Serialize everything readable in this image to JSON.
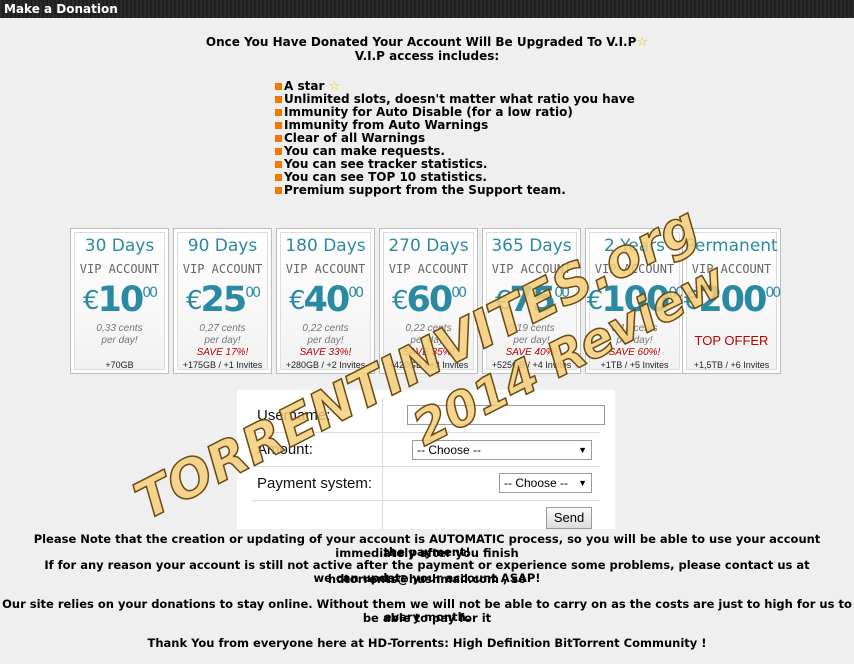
{
  "window": {
    "title": "Make a Donation"
  },
  "intro": {
    "headline": "Once You Have Donated Your Account Will Be Upgraded To V.I.P",
    "subline": "V.I.P access includes:"
  },
  "benefits": [
    "A star",
    "Unlimited slots, doesn't matter what ratio you have",
    "Immunity for Auto Disable (for a low ratio)",
    "Immunity from Auto Warnings",
    "Clear of all Warnings",
    "You can make requests.",
    "You can see tracker statistics.",
    "You can see TOP 10 statistics.",
    "Premium support from the Support team."
  ],
  "plans": [
    {
      "duration": "30 Days",
      "account": "VIP ACCOUNT",
      "currency": "€",
      "price": "10",
      "decimals": "00",
      "cents": "0,33 cents",
      "per": "per day!",
      "save": "",
      "extra": "+70GB"
    },
    {
      "duration": "90 Days",
      "account": "VIP ACCOUNT",
      "currency": "€",
      "price": "25",
      "decimals": "00",
      "cents": "0,27 cents",
      "per": "per day!",
      "save": "SAVE 17%!",
      "extra": "+175GB / +1 Invites"
    },
    {
      "duration": "180 Days",
      "account": "VIP ACCOUNT",
      "currency": "€",
      "price": "40",
      "decimals": "00",
      "cents": "0,22 cents",
      "per": "per day!",
      "save": "SAVE 33%!",
      "extra": "+280GB / +2 Invites"
    },
    {
      "duration": "270 Days",
      "account": "VIP ACCOUNT",
      "currency": "€",
      "price": "60",
      "decimals": "00",
      "cents": "0,22 cents",
      "per": "per day!",
      "save": "SAVE 35%!",
      "extra": "+420GB / +3 Invites"
    },
    {
      "duration": "365 Days",
      "account": "VIP ACCOUNT",
      "currency": "€",
      "price": "75",
      "decimals": "00",
      "cents": "0,19 cents",
      "per": "per day!",
      "save": "SAVE 40%!",
      "extra": "+525GB / +4 Invites"
    },
    {
      "duration": "2 Years",
      "account": "VIP ACCOUNT",
      "currency": "€",
      "price": "100",
      "decimals": "00",
      "cents": "0,13 cents",
      "per": "per day!",
      "save": "SAVE 60%!",
      "extra": "+1TB / +5 Invites"
    },
    {
      "duration": "Permanent",
      "account": "VIP ACCOUNT",
      "currency": "€",
      "price": "200",
      "decimals": "00",
      "cents": "",
      "per": "",
      "save": "TOP OFFER",
      "extra": "+1,5TB / +6 Invites"
    }
  ],
  "form": {
    "username_label": "Username:",
    "username_value": "",
    "amount_label": "Amount:",
    "amount_selected": "-- Choose --",
    "payment_label": "Payment system:",
    "payment_selected": "-- Choose --",
    "send_label": "Send"
  },
  "notes": {
    "line1": "Please Note that the creation or updating of your account is AUTOMATIC process, so you will be able to use your account immediately after you finish",
    "line2": "the payment!",
    "line3": "If for any reason your account is still not active after the payment or experience some problems, please contact us at hdtorrents@hushmail.com , so",
    "line4": "we can update your account ASAP!",
    "line5": "Our site relies on your donations to stay online. Without them we will not be able to carry on as the costs are just to high for us to be able to pay for it",
    "line6": "every month.",
    "thanks": "Thank You from everyone here at HD-Torrents: High Definition BitTorrent Community !"
  },
  "watermark": {
    "line1": "TORRENTINVITES.org",
    "line2": "2014 Review"
  }
}
